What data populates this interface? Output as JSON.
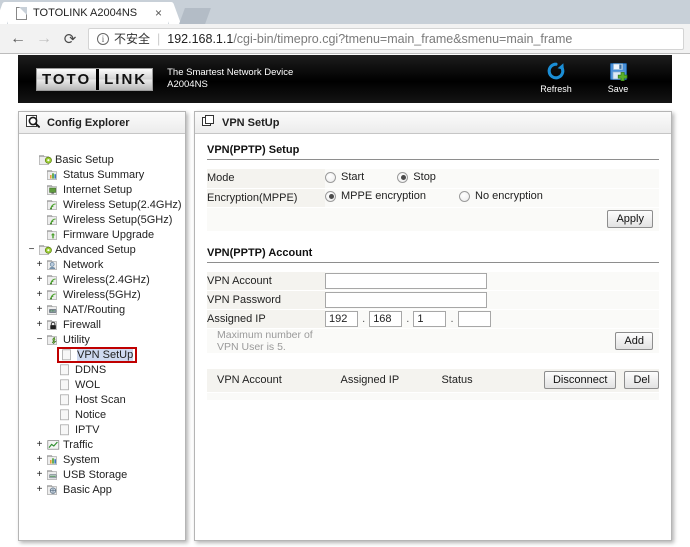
{
  "browser": {
    "tab": {
      "title": "TOTOLINK A2004NS",
      "favicon_icon": "page-icon",
      "close_icon": "×"
    },
    "newtab_icon": "new-tab-icon",
    "nav": {
      "back": "←",
      "forward": "→",
      "reload": "⟳"
    },
    "omnibox": {
      "info_icon": "ⓘ",
      "security_text": "不安全",
      "separator": "|",
      "host": "192.168.1.1",
      "path": "/cgi-bin/timepro.cgi?tmenu=main_frame&smenu=main_frame"
    }
  },
  "router_header": {
    "logo_left": "TOTO",
    "logo_right": "LINK",
    "tagline_line1": "The Smartest Network Device",
    "tagline_line2": "A2004NS",
    "actions": [
      {
        "label": "Refresh",
        "icon": "refresh-icon"
      },
      {
        "label": "Save",
        "icon": "save-icon"
      }
    ]
  },
  "sidebar": {
    "title": "Config Explorer",
    "title_icon": "config-explorer-icon",
    "tree": [
      {
        "label": "Basic Setup",
        "toggle": "",
        "icon": "folder-gear-icon",
        "indent": 0,
        "selected": false
      },
      {
        "label": "Status Summary",
        "toggle": "",
        "icon": "chart-icon",
        "indent": 1,
        "selected": false
      },
      {
        "label": "Internet Setup",
        "toggle": "",
        "icon": "monitor-icon",
        "indent": 1,
        "selected": false
      },
      {
        "label": "Wireless Setup(2.4GHz)",
        "toggle": "",
        "icon": "wireless-icon",
        "indent": 1,
        "selected": false
      },
      {
        "label": "Wireless Setup(5GHz)",
        "toggle": "",
        "icon": "wireless-icon",
        "indent": 1,
        "selected": false
      },
      {
        "label": "Firmware Upgrade",
        "toggle": "",
        "icon": "upgrade-icon",
        "indent": 1,
        "selected": false
      },
      {
        "label": "Advanced Setup",
        "toggle": "−",
        "icon": "folder-gear-icon",
        "indent": 0,
        "selected": false
      },
      {
        "label": "Network",
        "toggle": "+",
        "icon": "network-icon",
        "indent": 1,
        "selected": false
      },
      {
        "label": "Wireless(2.4GHz)",
        "toggle": "+",
        "icon": "wireless-icon",
        "indent": 1,
        "selected": false
      },
      {
        "label": "Wireless(5GHz)",
        "toggle": "+",
        "icon": "wireless-icon",
        "indent": 1,
        "selected": false
      },
      {
        "label": "NAT/Routing",
        "toggle": "+",
        "icon": "nat-routing-icon",
        "indent": 1,
        "selected": false
      },
      {
        "label": "Firewall",
        "toggle": "+",
        "icon": "lock-icon",
        "indent": 1,
        "selected": false
      },
      {
        "label": "Utility",
        "toggle": "−",
        "icon": "utility-icon",
        "indent": 1,
        "selected": false
      },
      {
        "label": "VPN SetUp",
        "toggle": "",
        "icon": "page-icon",
        "indent": 2,
        "selected": true
      },
      {
        "label": "DDNS",
        "toggle": "",
        "icon": "page-icon",
        "indent": 2,
        "selected": false
      },
      {
        "label": "WOL",
        "toggle": "",
        "icon": "page-icon",
        "indent": 2,
        "selected": false
      },
      {
        "label": "Host Scan",
        "toggle": "",
        "icon": "page-icon",
        "indent": 2,
        "selected": false
      },
      {
        "label": "Notice",
        "toggle": "",
        "icon": "page-icon",
        "indent": 2,
        "selected": false
      },
      {
        "label": "IPTV",
        "toggle": "",
        "icon": "page-icon",
        "indent": 2,
        "selected": false
      },
      {
        "label": "Traffic",
        "toggle": "+",
        "icon": "traffic-icon",
        "indent": 1,
        "selected": false
      },
      {
        "label": "System",
        "toggle": "+",
        "icon": "chart-icon",
        "indent": 1,
        "selected": false
      },
      {
        "label": "USB Storage",
        "toggle": "+",
        "icon": "usb-icon",
        "indent": 1,
        "selected": false
      },
      {
        "label": "Basic App",
        "toggle": "+",
        "icon": "app-icon",
        "indent": 1,
        "selected": false
      }
    ]
  },
  "main": {
    "title": "VPN SetUp",
    "title_icon": "windows-icon",
    "setup": {
      "heading": "VPN(PPTP) Setup",
      "mode_label": "Mode",
      "mode_options": [
        {
          "label": "Start",
          "selected": false
        },
        {
          "label": "Stop",
          "selected": true
        }
      ],
      "encryption_label": "Encryption(MPPE)",
      "encryption_options": [
        {
          "label": "MPPE encryption",
          "selected": true
        },
        {
          "label": "No encryption",
          "selected": false
        }
      ],
      "apply_label": "Apply"
    },
    "account": {
      "heading": "VPN(PPTP) Account",
      "vpn_account_label": "VPN Account",
      "vpn_account_value": "",
      "vpn_password_label": "VPN Password",
      "vpn_password_value": "",
      "assigned_ip_label": "Assigned IP",
      "assigned_ip_octets": [
        "192",
        "168",
        "1",
        ""
      ],
      "note": "Maximum number of VPN User is 5.",
      "add_label": "Add"
    },
    "list": {
      "columns": [
        "VPN Account",
        "Assigned IP",
        "Status"
      ],
      "disconnect_label": "Disconnect",
      "del_label": "Del",
      "rows": []
    }
  },
  "colors": {
    "header_bg": "#000000",
    "highlight_border": "#c00000",
    "selection_bg": "#cfd9f0",
    "refresh_icon": "#1b8ed6",
    "save_icon": "#3b7fc4"
  }
}
